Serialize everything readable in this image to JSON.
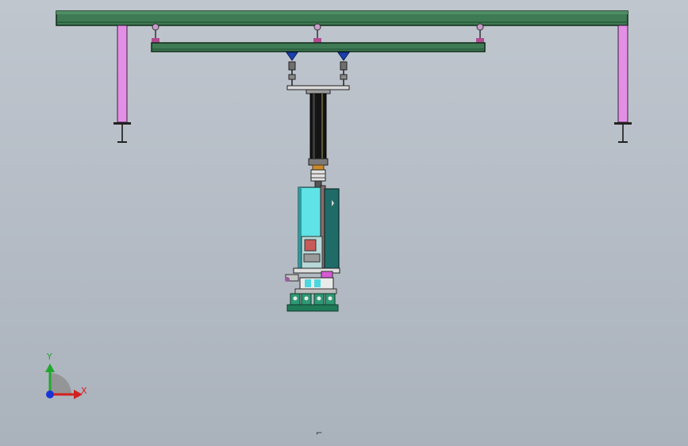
{
  "viewport": {
    "background_top": "#bfc6ce",
    "background_bottom": "#aab2bc"
  },
  "model": {
    "frame_color": "#3e7a54",
    "post_color": "#e38fe6",
    "cylinder_color": "#111111",
    "cyan_panel_color": "#5fe3e6",
    "teal_panel_color": "#1f6b68",
    "gripper_color": "#2d9a74"
  },
  "triad": {
    "y_label": "Y",
    "x_label": "X",
    "y_color": "#1fa82c",
    "x_color": "#d41f1f",
    "z_color": "#1a35d6"
  },
  "origin_marker": {
    "icon": "origin-marker-icon",
    "glyph": "⌐"
  }
}
